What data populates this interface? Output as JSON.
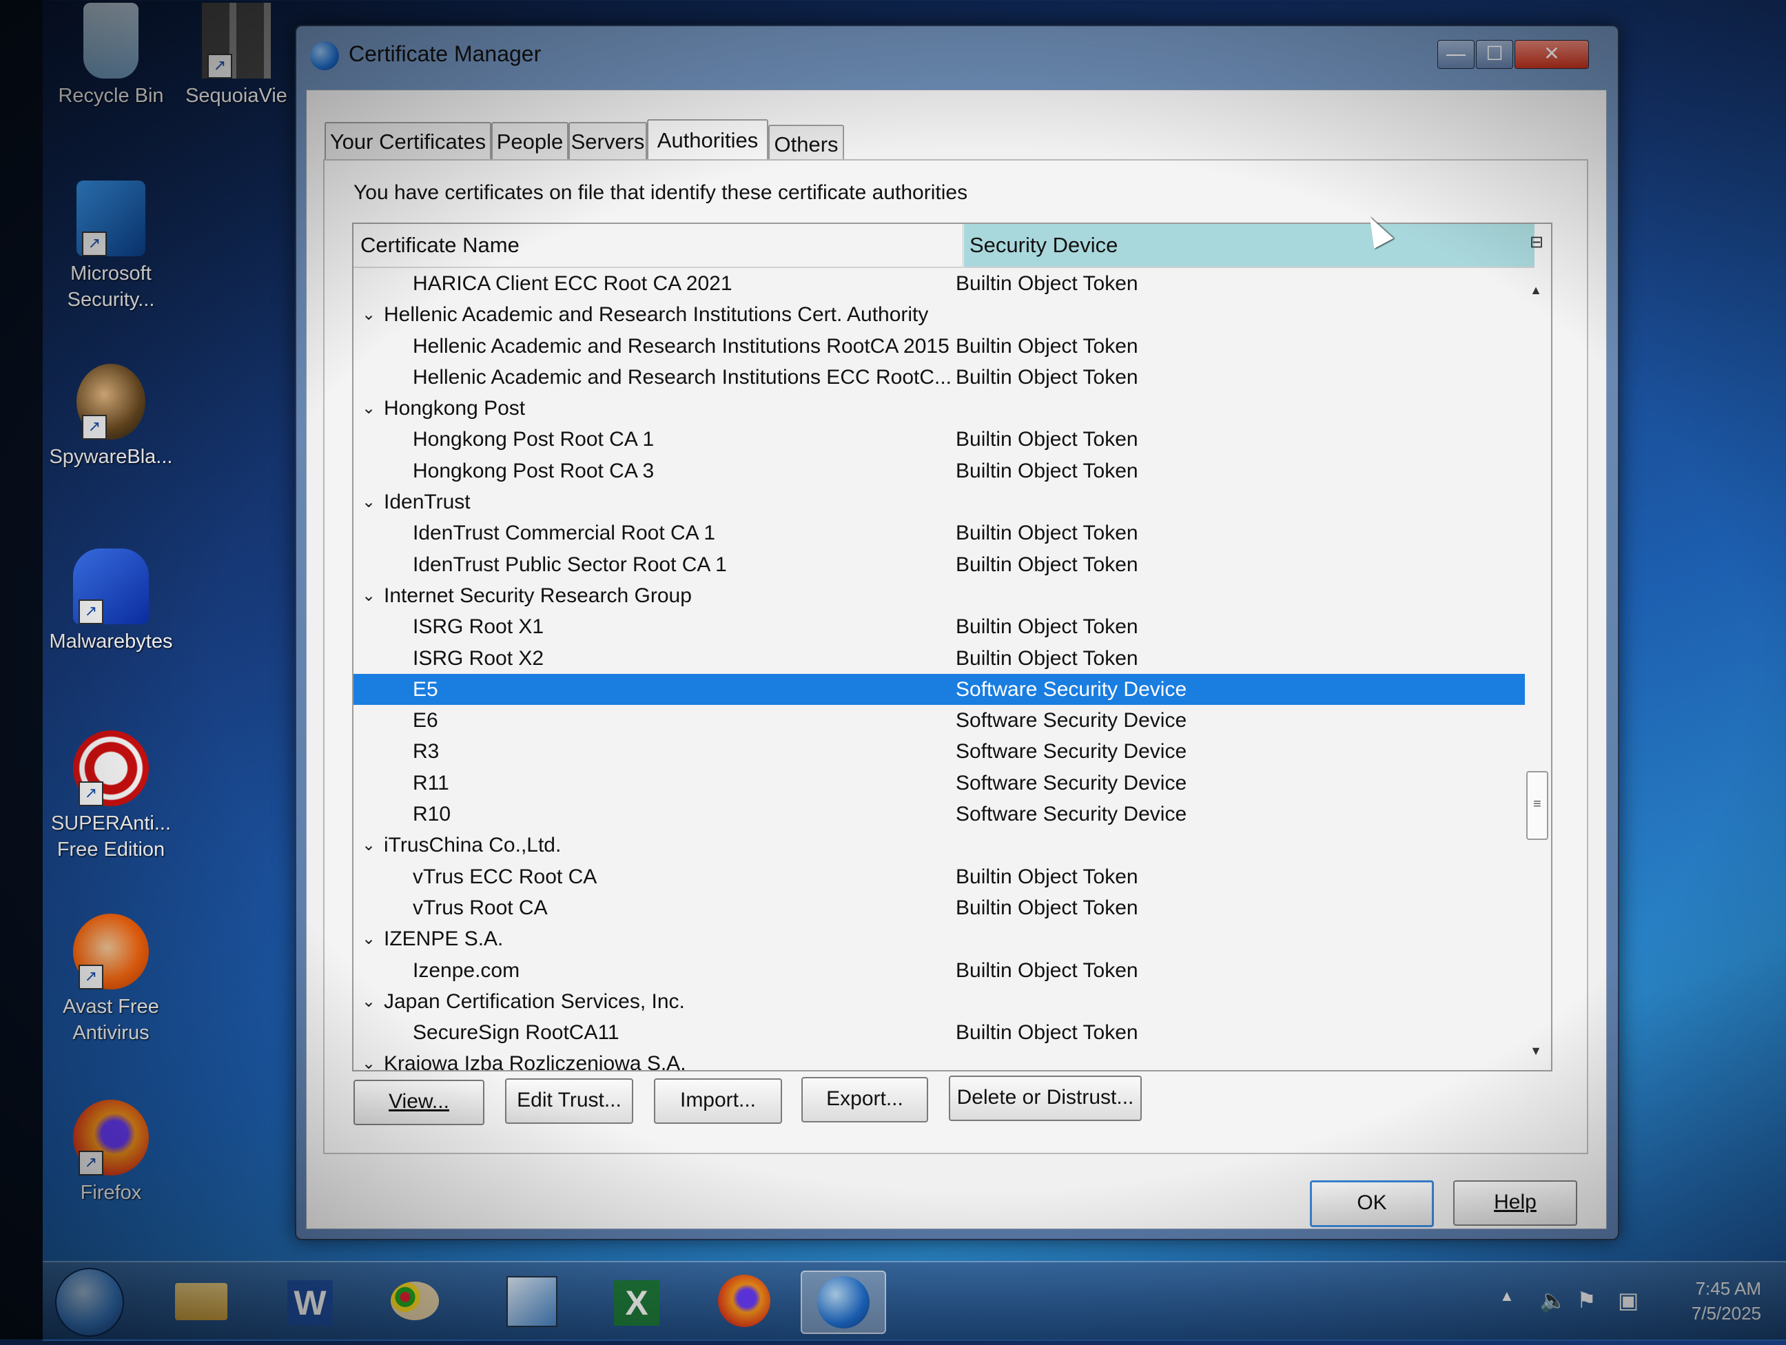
{
  "desktop": {
    "icons": [
      {
        "label1": "Recycle Bin",
        "label2": ""
      },
      {
        "label1": "SequoiaVie",
        "label2": ""
      },
      {
        "label1": "Microsoft",
        "label2": "Security..."
      },
      {
        "label1": "SpywareBla...",
        "label2": ""
      },
      {
        "label1": "Malwarebytes",
        "label2": ""
      },
      {
        "label1": "SUPERAnti...",
        "label2": "Free Edition"
      },
      {
        "label1": "Avast Free",
        "label2": "Antivirus"
      },
      {
        "label1": "Firefox",
        "label2": ""
      }
    ]
  },
  "window": {
    "title": "Certificate Manager",
    "minimize": "—",
    "maximize": "☐",
    "close": "✕"
  },
  "tabs": [
    "Your Certificates",
    "People",
    "Servers",
    "Authorities",
    "Others"
  ],
  "active_tab": "Authorities",
  "intro": "You have certificates on file that identify these certificate authorities",
  "columns": {
    "name": "Certificate Name",
    "device": "Security Device"
  },
  "rows": [
    {
      "type": "cert",
      "name": "HARICA Client ECC Root CA 2021",
      "device": "Builtin Object Token"
    },
    {
      "type": "group",
      "name": "Hellenic Academic and Research Institutions Cert. Authority",
      "device": ""
    },
    {
      "type": "cert",
      "name": "Hellenic Academic and Research Institutions RootCA 2015",
      "device": "Builtin Object Token"
    },
    {
      "type": "cert",
      "name": "Hellenic Academic and Research Institutions ECC RootC...",
      "device": "Builtin Object Token"
    },
    {
      "type": "group",
      "name": "Hongkong Post",
      "device": ""
    },
    {
      "type": "cert",
      "name": "Hongkong Post Root CA 1",
      "device": "Builtin Object Token"
    },
    {
      "type": "cert",
      "name": "Hongkong Post Root CA 3",
      "device": "Builtin Object Token"
    },
    {
      "type": "group",
      "name": "IdenTrust",
      "device": ""
    },
    {
      "type": "cert",
      "name": "IdenTrust Commercial Root CA 1",
      "device": "Builtin Object Token"
    },
    {
      "type": "cert",
      "name": "IdenTrust Public Sector Root CA 1",
      "device": "Builtin Object Token"
    },
    {
      "type": "group",
      "name": "Internet Security Research Group",
      "device": ""
    },
    {
      "type": "cert",
      "name": "ISRG Root X1",
      "device": "Builtin Object Token"
    },
    {
      "type": "cert",
      "name": "ISRG Root X2",
      "device": "Builtin Object Token"
    },
    {
      "type": "cert",
      "name": "E5",
      "device": "Software Security Device",
      "selected": true
    },
    {
      "type": "cert",
      "name": "E6",
      "device": "Software Security Device"
    },
    {
      "type": "cert",
      "name": "R3",
      "device": "Software Security Device"
    },
    {
      "type": "cert",
      "name": "R11",
      "device": "Software Security Device"
    },
    {
      "type": "cert",
      "name": "R10",
      "device": "Software Security Device"
    },
    {
      "type": "group",
      "name": "iTrusChina Co.,Ltd.",
      "device": ""
    },
    {
      "type": "cert",
      "name": "vTrus ECC Root CA",
      "device": "Builtin Object Token"
    },
    {
      "type": "cert",
      "name": "vTrus Root CA",
      "device": "Builtin Object Token"
    },
    {
      "type": "group",
      "name": "IZENPE S.A.",
      "device": ""
    },
    {
      "type": "cert",
      "name": "Izenpe.com",
      "device": "Builtin Object Token"
    },
    {
      "type": "group",
      "name": "Japan Certification Services, Inc.",
      "device": ""
    },
    {
      "type": "cert",
      "name": "SecureSign RootCA11",
      "device": "Builtin Object Token"
    },
    {
      "type": "group",
      "name": "Krajowa Izba Rozliczeniowa S.A.",
      "device": ""
    }
  ],
  "buttons": {
    "view": "View...",
    "edit_trust": "Edit Trust...",
    "import": "Import...",
    "export": "Export...",
    "delete": "Delete or Distrust...",
    "ok": "OK",
    "help": "Help"
  },
  "taskbar": {
    "time": "7:45 AM",
    "date": "7/5/2025"
  },
  "colors": {
    "selection": "#1a7de0",
    "sorted_header": "#a9d8dc",
    "window_frame": "#6f8fb8"
  }
}
